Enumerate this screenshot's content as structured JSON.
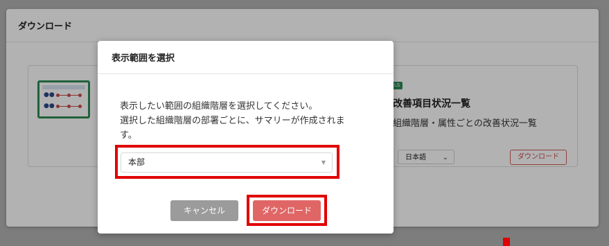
{
  "page": {
    "section_title": "ダウンロード",
    "report": {
      "badge": "LS",
      "title": "改善項目状況一覧",
      "description": "組織階層・属性ごとの改善状況一覧",
      "language": "日本語",
      "download_label": "ダウンロード"
    }
  },
  "modal": {
    "title": "表示範囲を選択",
    "body_lines": [
      "表示したい範囲の組織階層を選択してください。",
      "選択した組織階層の部署ごとに、サマリーが作成されま",
      "す。"
    ],
    "select": {
      "value": "本部"
    },
    "cancel_label": "キャンセル",
    "download_label": "ダウンロード"
  },
  "colors": {
    "accent_red": "#e06666",
    "highlight_red": "#e00000",
    "brand_green": "#2e8b57",
    "cancel_gray": "#9b9b9b"
  }
}
